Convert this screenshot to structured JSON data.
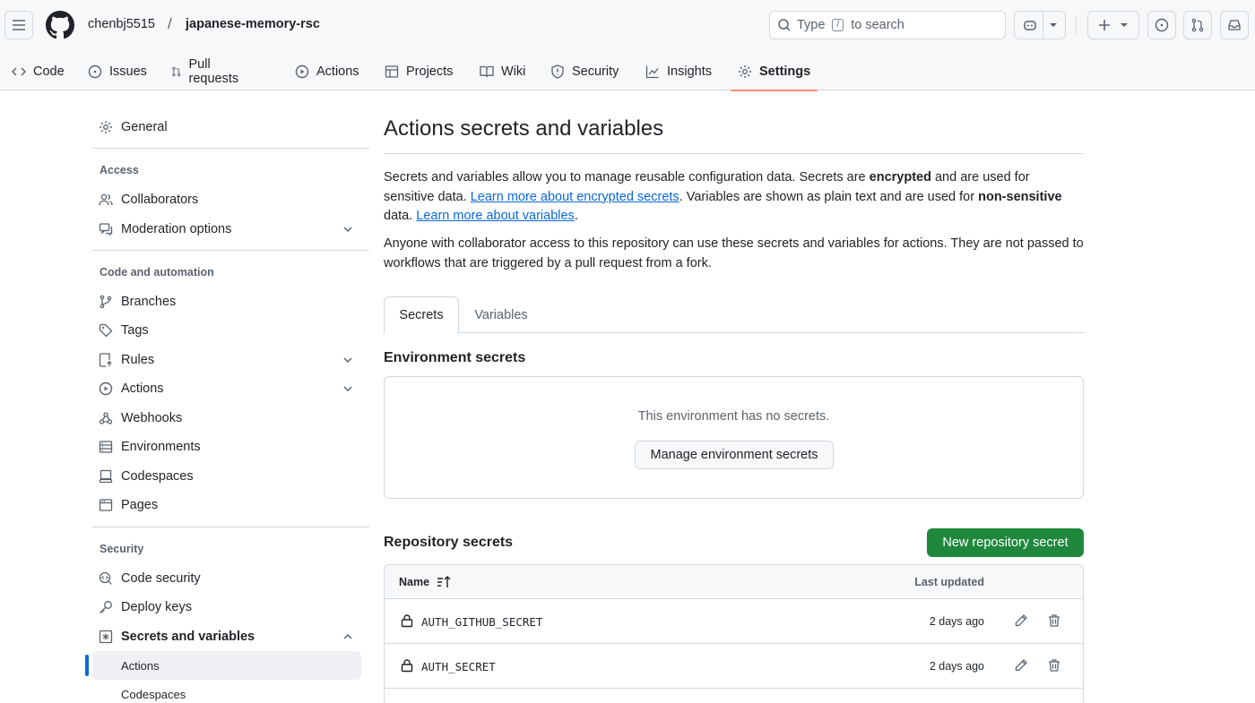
{
  "header": {
    "owner": "chenbj5515",
    "separator": "/",
    "repo": "japanese-memory-rsc",
    "search": {
      "before": "Type",
      "key": "/",
      "after": "to search"
    }
  },
  "tabs": [
    {
      "label": "Code",
      "icon": "code-icon"
    },
    {
      "label": "Issues",
      "icon": "issue-icon"
    },
    {
      "label": "Pull requests",
      "icon": "pull-request-icon"
    },
    {
      "label": "Actions",
      "icon": "play-icon"
    },
    {
      "label": "Projects",
      "icon": "table-icon"
    },
    {
      "label": "Wiki",
      "icon": "book-icon"
    },
    {
      "label": "Security",
      "icon": "shield-icon"
    },
    {
      "label": "Insights",
      "icon": "graph-icon"
    },
    {
      "label": "Settings",
      "icon": "gear-icon",
      "active": true
    }
  ],
  "sidebar": {
    "general": "General",
    "access_heading": "Access",
    "collaborators": "Collaborators",
    "moderation": "Moderation options",
    "code_heading": "Code and automation",
    "branches": "Branches",
    "tags": "Tags",
    "rules": "Rules",
    "actions": "Actions",
    "webhooks": "Webhooks",
    "environments": "Environments",
    "codespaces": "Codespaces",
    "pages": "Pages",
    "security_heading": "Security",
    "code_security": "Code security",
    "deploy_keys": "Deploy keys",
    "secrets_vars": "Secrets and variables",
    "sub_actions": "Actions",
    "sub_codespaces": "Codespaces"
  },
  "main": {
    "title": "Actions secrets and variables",
    "p1": {
      "t1": "Secrets and variables allow you to manage reusable configuration data. Secrets are ",
      "b1": "encrypted",
      "t2": " and are used for sensitive data. ",
      "link1": "Learn more about encrypted secrets",
      "t3": ". Variables are shown as plain text and are used for ",
      "b2": "non-sensitive",
      "t4": " data. ",
      "link2": "Learn more about variables",
      "t5": "."
    },
    "p2": "Anyone with collaborator access to this repository can use these secrets and variables for actions. They are not passed to workflows that are triggered by a pull request from a fork.",
    "subtabs": {
      "secrets": "Secrets",
      "variables": "Variables"
    },
    "env_heading": "Environment secrets",
    "env_empty": "This environment has no secrets.",
    "env_button": "Manage environment secrets",
    "repo_heading": "Repository secrets",
    "new_secret_button": "New repository secret",
    "table": {
      "col_name": "Name",
      "col_updated": "Last updated",
      "rows": [
        {
          "name": "AUTH_GITHUB_SECRET",
          "updated": "2 days ago"
        },
        {
          "name": "AUTH_SECRET",
          "updated": "2 days ago"
        }
      ]
    }
  }
}
